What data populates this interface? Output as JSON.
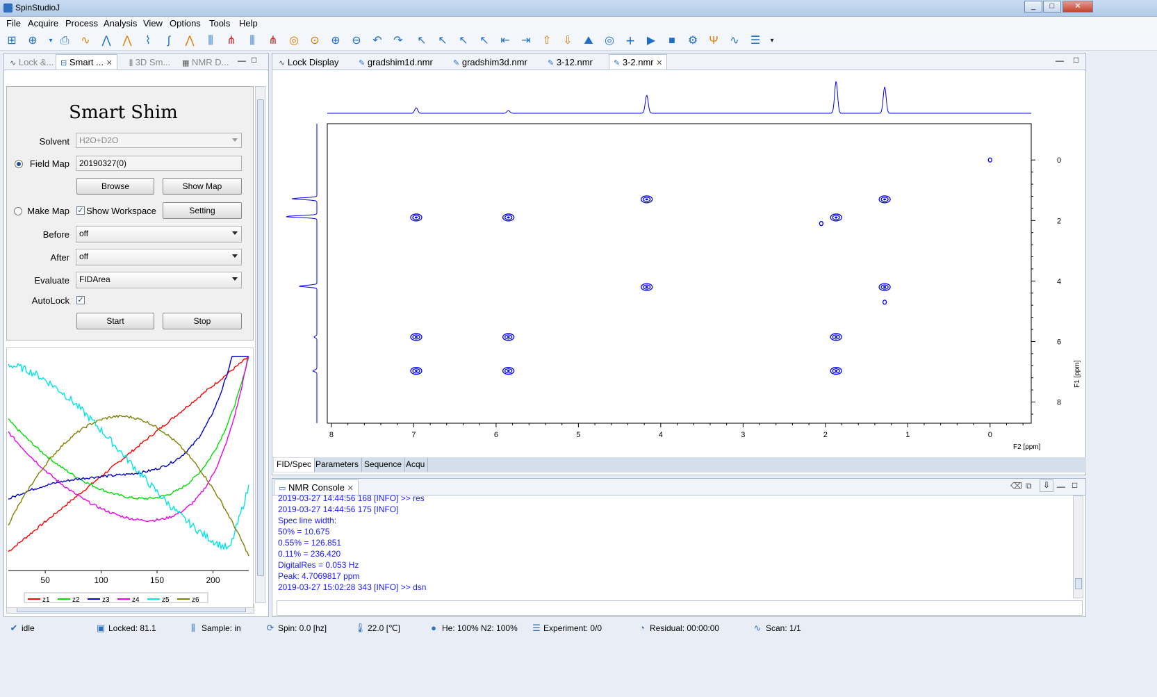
{
  "window": {
    "title": "SpinStudioJ"
  },
  "menu": [
    "File",
    "Acquire",
    "Process",
    "Analysis",
    "View",
    "Options",
    "Tools",
    "Help"
  ],
  "left_tabs": [
    "Lock &...",
    "Smart ...",
    "3D Sm...",
    "NMR D..."
  ],
  "shim": {
    "title": "Smart Shim",
    "solvent_label": "Solvent",
    "solvent_value": "H2O+D2O",
    "field_map_label": "Field Map",
    "field_map_value": "20190327(0)",
    "browse": "Browse",
    "show_map": "Show Map",
    "make_map_label": "Make Map",
    "show_workspace_label": "Show Workspace",
    "setting": "Setting",
    "before_label": "Before",
    "before_value": "off",
    "after_label": "After",
    "after_value": "off",
    "evaluate_label": "Evaluate",
    "evaluate_value": "FIDArea",
    "autolock_label": "AutoLock",
    "start": "Start",
    "stop": "Stop"
  },
  "shim_chart": {
    "x_ticks": [
      "50",
      "100",
      "150",
      "200"
    ],
    "legend": [
      "z1",
      "z2",
      "z3",
      "z4",
      "z5",
      "z6"
    ],
    "colors": [
      "#ff0000",
      "#00dd00",
      "#0000cc",
      "#ee00ee",
      "#00e5e5",
      "#808000"
    ]
  },
  "editor_tabs": [
    "Lock Display",
    "gradshim1d.nmr",
    "gradshim3d.nmr",
    "3-12.nmr",
    "3-2.nmr"
  ],
  "chart_data": {
    "type": "scatter",
    "title": "",
    "xlabel": "F2 [ppm]",
    "ylabel": "F1 [ppm]",
    "x_ticks": [
      "8",
      "7",
      "6",
      "5",
      "4",
      "3",
      "2",
      "1",
      "0"
    ],
    "y_ticks": [
      "0",
      "2",
      "4",
      "6",
      "8"
    ],
    "xlim": [
      8.05,
      -0.5
    ],
    "ylim": [
      -1.2,
      8.7
    ],
    "peaks": [
      {
        "x": 0.0,
        "y": 0.0
      },
      {
        "x": 4.17,
        "y": 1.3
      },
      {
        "x": 1.28,
        "y": 1.3
      },
      {
        "x": 6.97,
        "y": 1.9
      },
      {
        "x": 5.85,
        "y": 1.9
      },
      {
        "x": 2.05,
        "y": 2.1
      },
      {
        "x": 1.87,
        "y": 1.9
      },
      {
        "x": 4.17,
        "y": 4.2
      },
      {
        "x": 1.28,
        "y": 4.2
      },
      {
        "x": 1.28,
        "y": 4.7
      },
      {
        "x": 6.97,
        "y": 5.85
      },
      {
        "x": 5.85,
        "y": 5.85
      },
      {
        "x": 1.87,
        "y": 5.85
      },
      {
        "x": 6.97,
        "y": 6.97
      },
      {
        "x": 5.85,
        "y": 6.97
      },
      {
        "x": 1.87,
        "y": 6.97
      }
    ],
    "projection_peaks": [
      6.97,
      5.85,
      4.17,
      1.87,
      1.28
    ]
  },
  "bottom_tabs": [
    "FID/Spec",
    "Parameters",
    "Sequence",
    "Acqu"
  ],
  "console": {
    "title": "NMR Console",
    "lines": [
      "2019-03-27 14:44:56 168 [INFO] >> res",
      "2019-03-27 14:44:56 175 [INFO]",
      "Spec line width:",
      "50% = 10.675",
      "0.55% = 126.851",
      "0.11% = 236.420",
      "DigitalRes = 0.053 Hz",
      "Peak: 4.7069817 ppm",
      "2019-03-27 15:02:28 343 [INFO] >> dsn"
    ]
  },
  "status": {
    "idle": "idle",
    "locked": "Locked: 81.1",
    "sample": "Sample: in",
    "spin": "Spin: 0.0 [hz]",
    "temp": "22.0 [℃]",
    "gas": "He: 100% N2: 100%",
    "experiment": "Experiment: 0/0",
    "residual": "Residual: 00:00:00",
    "scan": "Scan: 1/1"
  }
}
